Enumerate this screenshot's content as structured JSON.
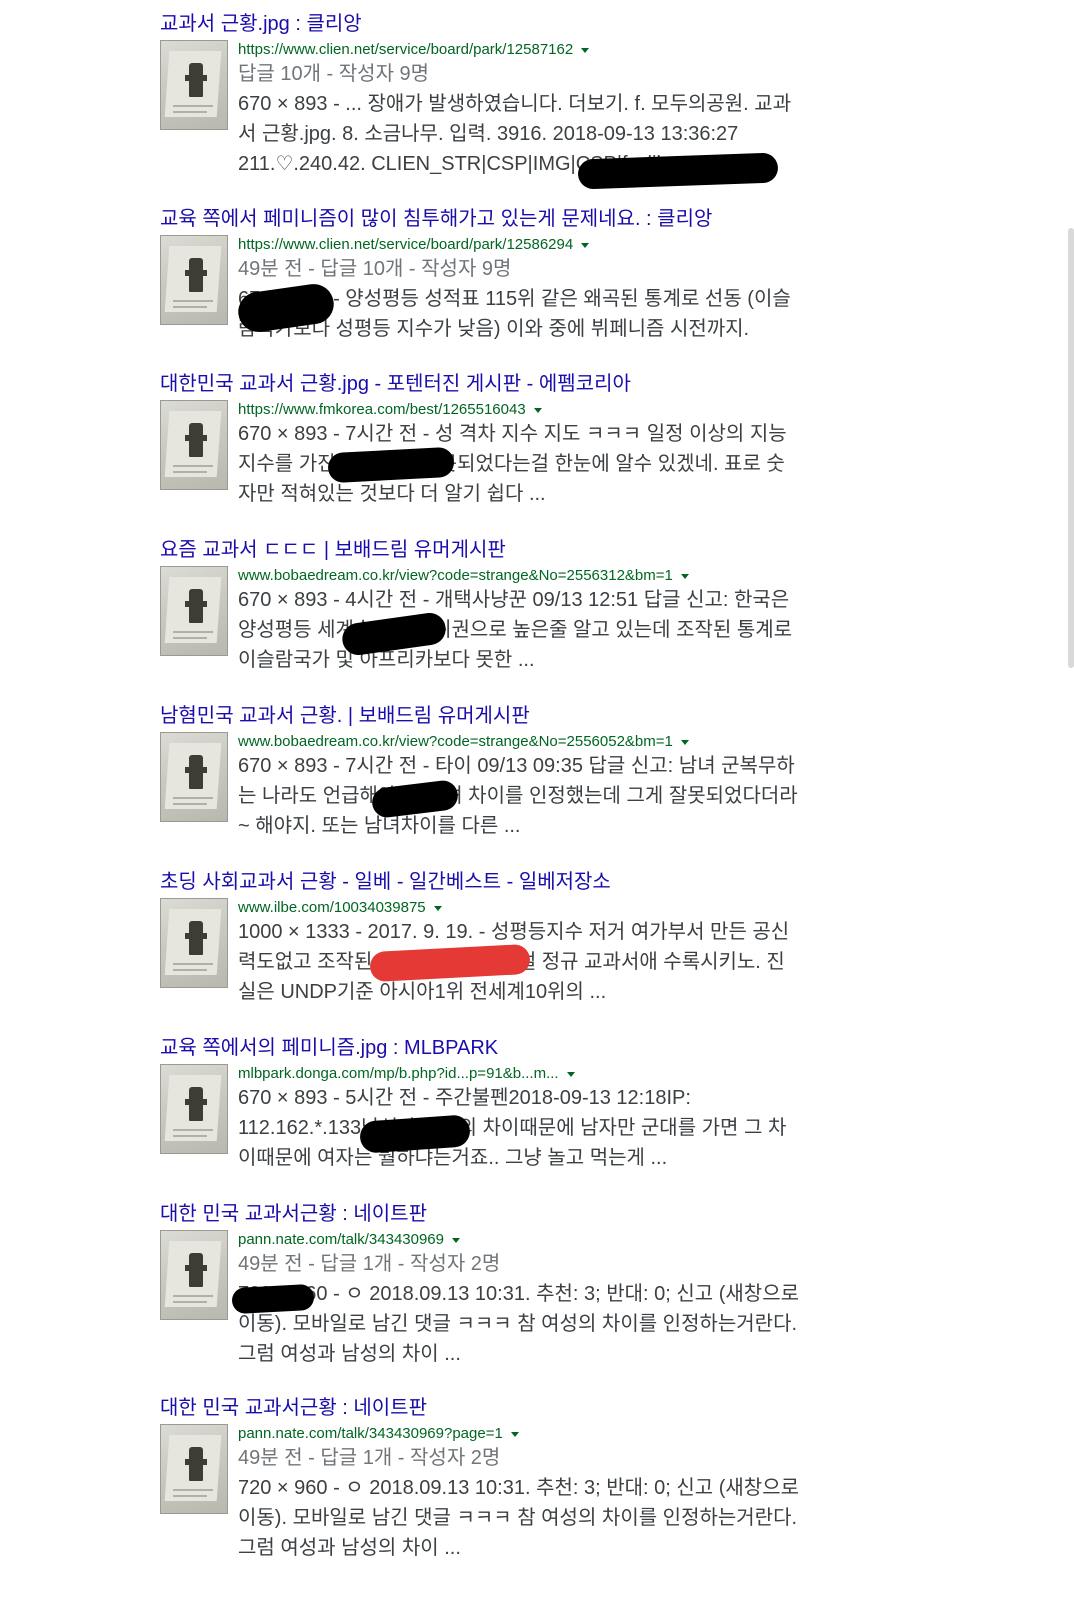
{
  "results": [
    {
      "title": "교과서 근황.jpg : 클리앙",
      "url": "https://www.clien.net/service/board/park/12587162",
      "meta": "답글 10개 - 작성자 9명",
      "dims": "670 × 893",
      "lines": [
        "670 × 893 - ... 장애가 발생하였습니다. 더보기. f. 모두의공원. 교과",
        "서 근황.jpg. 8. 소금나무. 입력. 3916. 2018-09-13 13:36:27",
        "211.♡.240.42. CLIEN_STR|CSP|IMG|CSP|fr-dib"
      ]
    },
    {
      "title": "교육 쪽에서 페미니즘이 많이 침투해가고 있는게 문제네요. : 클리앙",
      "url": "https://www.clien.net/service/board/park/12586294",
      "meta": "49분 전 - 답글 10개 - 작성자 9명",
      "lines": [
        "670 × 893 - 양성평등 성적표 115위 같은 왜곡된 통계로 선동 (이슬",
        "람국가보다 성평등 지수가 낮음) 이와 중에 뷔페니즘 시전까지."
      ]
    },
    {
      "title": "대한민국 교과서 근황.jpg - 포텐터진 게시판 - 에펨코리아",
      "url": "https://www.fmkorea.com/best/1265516043",
      "meta": "",
      "lines": [
        "670 × 893 - 7시간 전 - 성 격차 지수 지도 ㅋㅋㅋ 일정 이상의 지능",
        "지수를 가진 사람이면 잘못되었다는걸 한눈에 알수 있겠네. 표로 숫",
        "자만 적혀있는 것보다 더 알기 쉽다 ..."
      ]
    },
    {
      "title": "요즘 교과서 ㄷㄷㄷ | 보배드림 유머게시판",
      "url": "www.bobaedream.co.kr/view?code=strange&No=2556312&bm=1",
      "meta": "",
      "lines": [
        "670 × 893 - 4시간 전 - 개택사냥꾼 09/13 12:51 답글 신고: 한국은",
        "양성평등 세계순위가 상위권으로 높은줄 알고 있는데 조작된 통계로",
        "이슬람국가 및 아프리카보다 못한 ..."
      ]
    },
    {
      "title": "남혐민국 교과서 근황. | 보배드림 유머게시판",
      "url": "www.bobaedream.co.kr/view?code=strange&No=2556052&bm=1",
      "meta": "",
      "lines": [
        "670 × 893 - 7시간 전 - 타이 09/13 09:35 답글 신고: 남녀 군복무하",
        "는 나라도 언급해야지. 남녀 차이를 인정했는데 그게 잘못되었다더라",
        "~ 해야지. 또는 남녀차이를 다른 ..."
      ]
    },
    {
      "title": "초딩 사회교과서 근황 - 일베 - 일간베스트 - 일베저장소",
      "url": "www.ilbe.com/10034039875",
      "meta": "",
      "lines": [
        "1000 × 1333 - 2017. 9. 19. - 성평등지수 저거 여가부서 만든 공신",
        "력도없고 조작된 통계 자료인데 저걸 정규 교과서애 수록시키노. 진",
        "실은 UNDP기준 아시아1위 전세계10위의 ..."
      ]
    },
    {
      "title": "교육 쪽에서의 페미니즘.jpg : MLBPARK",
      "url": "mlbpark.donga.com/mp/b.php?id...p=91&b...m...",
      "meta": "",
      "lines": [
        "670 × 893 - 5시간 전 - 주간불펜2018-09-13 12:18IP:",
        "112.162.*.133남성과 여성의 차이때문에 남자만 군대를 가면 그 차",
        "이때문에 여자는 뭘하냐는거죠.. 그냥 놀고 먹는게 ..."
      ]
    },
    {
      "title": "대한 민국 교과서근황 : 네이트판",
      "url": "pann.nate.com/talk/343430969",
      "meta": "49분 전 - 답글 1개 - 작성자 2명",
      "lines": [
        "720 × 960 - ㅇ 2018.09.13 10:31. 추천: 3; 반대: 0; 신고 (새창으로",
        "이동). 모바일로 남긴 댓글 ㅋㅋㅋ 참 여성의 차이를 인정하는거란다.",
        "그럼 여성과 남성의 차이 ..."
      ]
    },
    {
      "title": "대한 민국 교과서근황 : 네이트판",
      "url": "pann.nate.com/talk/343430969?page=1",
      "meta": "49분 전 - 답글 1개 - 작성자 2명",
      "lines": [
        "720 × 960 - ㅇ 2018.09.13 10:31. 추천: 3; 반대: 0; 신고 (새창으로",
        "이동). 모바일로 남긴 댓글 ㅋㅋㅋ 참 여성의 차이를 인정하는거란다.",
        "그럼 여성과 남성의 차이 ..."
      ]
    }
  ]
}
